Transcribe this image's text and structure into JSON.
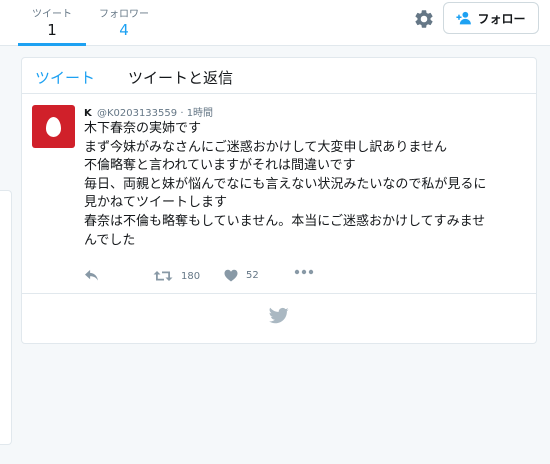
{
  "profile_nav": {
    "tweets": {
      "label": "ツイート",
      "value": "1"
    },
    "following": {
      "label": "フォロワー",
      "value": "4"
    },
    "settings_icon": "gear-icon",
    "follow_button": {
      "label": "フォロー",
      "icon": "add-user-icon"
    }
  },
  "colors": {
    "accent": "#1da1f2",
    "avatar_bg": "#d0202a",
    "muted_text": "#657786",
    "border": "#e1e8ed",
    "page_bg": "#f5f8fa"
  },
  "timeline": {
    "tabs": [
      {
        "label": "ツイート",
        "active": true
      },
      {
        "label": "ツイートと返信",
        "active": false
      }
    ],
    "tweet": {
      "display_name": "K",
      "handle": "@K0203133559",
      "separator": "·",
      "time": "1時間",
      "avatar_icon": "egg-avatar",
      "lines": [
        "木下春奈の実姉です",
        "まず今妹がみなさんにご迷惑おかけして大変申し訳ありません",
        "不倫略奪と言われていますがそれは間違いです",
        "毎日、両親と妹が悩んでなにも言えない状況みたいなので私が見るに",
        "見かねてツイートします",
        "春奈は不倫も略奪もしていません。本当にご迷惑おかけしてすみませ",
        "んでした"
      ],
      "actions": {
        "reply_icon": "reply-icon",
        "retweet_icon": "retweet-icon",
        "retweet_count": "180",
        "like_icon": "heart-icon",
        "like_count": "52",
        "more_icon": "more-icon"
      }
    },
    "footer_icon": "twitter-bird-icon"
  }
}
